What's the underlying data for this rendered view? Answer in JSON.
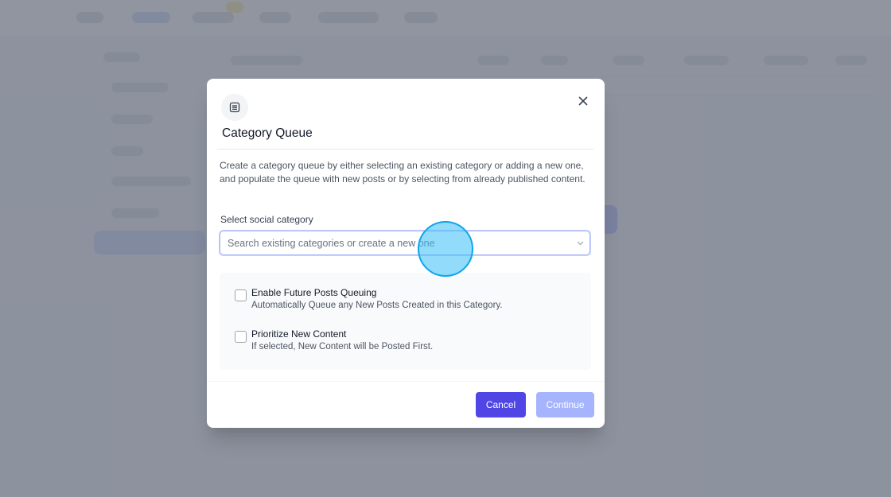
{
  "modal": {
    "title": "Category Queue",
    "icon": "list-icon",
    "close_icon": "close-icon",
    "description": "Create a category queue by either selecting an existing category or adding a new one, and populate the queue with new posts or by selecting from already published content.",
    "select": {
      "label": "Select social category",
      "placeholder": "Search existing categories or create a new one",
      "value": ""
    },
    "options": [
      {
        "title": "Enable Future Posts Queuing",
        "subtitle": "Automatically Queue any New Posts Created in this Category.",
        "checked": false
      },
      {
        "title": "Prioritize New Content",
        "subtitle": "If selected, New Content will be Posted First.",
        "checked": false
      }
    ],
    "buttons": {
      "cancel": "Cancel",
      "continue": "Continue"
    }
  },
  "colors": {
    "primary": "#4f46e5",
    "primary_disabled": "#a5b4fc",
    "overlay": "#6b7280",
    "click_indicator": "#38bdf8"
  }
}
